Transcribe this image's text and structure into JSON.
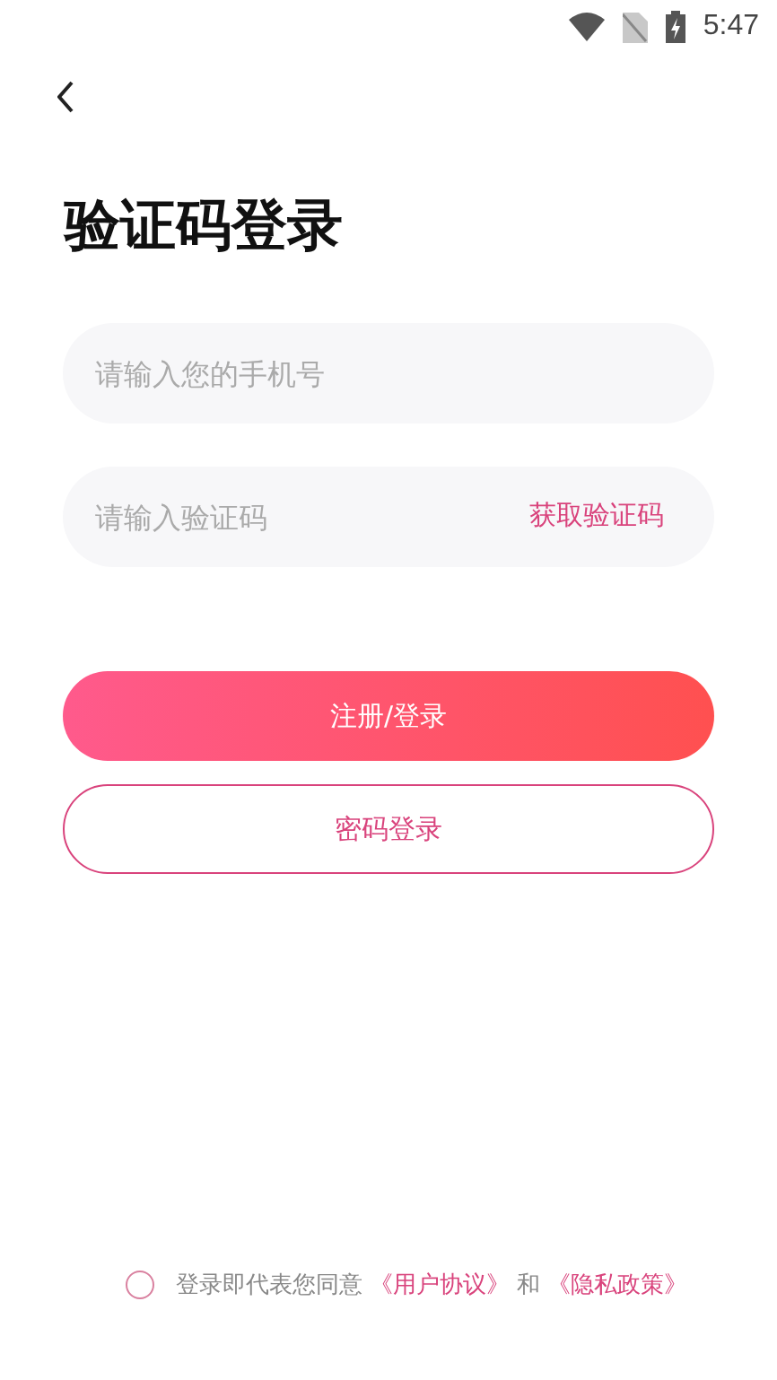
{
  "status_bar": {
    "time": "5:47"
  },
  "title": "验证码登录",
  "phone_field": {
    "placeholder": "请输入您的手机号"
  },
  "code_field": {
    "placeholder": "请输入验证码",
    "action": "获取验证码"
  },
  "buttons": [
    {
      "kind": "primary",
      "label": "注册/登录"
    },
    {
      "kind": "outline",
      "label": "密码登录"
    }
  ],
  "agreement": {
    "checked": false,
    "text": "登录即代表您同意",
    "links": [
      "《用户协议》",
      "《隐私政策》"
    ],
    "joiner": "和"
  }
}
